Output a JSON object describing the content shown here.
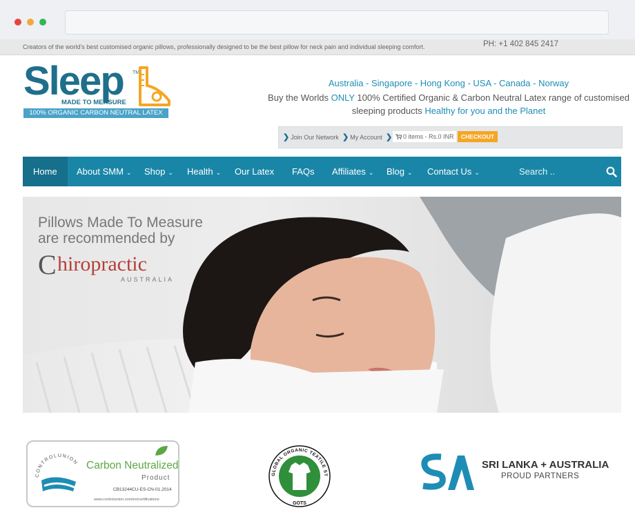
{
  "browser": {
    "window_controls": [
      "close",
      "minimize",
      "maximize"
    ]
  },
  "topbar": {
    "tagline": "Creators of the world's best customised organic pillows, professionally designed to be the best pillow for neck pain and individual sleeping comfort.",
    "phone": "PH: +1 402 845 2417"
  },
  "logo": {
    "word": "Sleep",
    "tm": "TM",
    "subtitle": "MADE TO MEASURE",
    "band": "100% ORGANIC CARBON NEUTRAL LATEX"
  },
  "header": {
    "countries": "Australia - Singapore - Hong Kong - USA - Canada - Norway",
    "buy_prefix": "Buy the Worlds ",
    "buy_only": "ONLY",
    "buy_rest": " 100% Certified Organic & Carbon Neutral Latex range of customised sleeping products ",
    "buy_healthy": "Healthy for you and the Planet"
  },
  "account_bar": {
    "join": "Join Our Network",
    "account": "My Account",
    "cart": "0 items - Rs.0 INR",
    "checkout": "CHECKOUT"
  },
  "nav": {
    "items": [
      {
        "label": "Home"
      },
      {
        "label": "About SMM"
      },
      {
        "label": "Shop"
      },
      {
        "label": "Health"
      },
      {
        "label": "Our Latex"
      },
      {
        "label": "FAQs"
      },
      {
        "label": "Affiliates"
      },
      {
        "label": "Blog"
      },
      {
        "label": "Contact Us"
      }
    ],
    "search_placeholder": "Search .."
  },
  "hero": {
    "line1": "Pillows Made To Measure",
    "line2": "are recommended by",
    "chiro_c": "C",
    "chiro_rest": "hiropractic",
    "chiro_sub": "AUSTRALIA"
  },
  "partners": {
    "carbon": {
      "arc_text": "CONTROLUNION",
      "title": "Carbon Neutralized",
      "product": "Product",
      "code": "CB13244CU-ES-CN-01.2014",
      "url": "www.controlunion.com/en/certifications"
    },
    "gots": {
      "ring_text": "GLOBAL ORGANIC TEXTILE STANDARD",
      "bottom": "GOTS"
    },
    "sa": {
      "line1": "SRI LANKA + AUSTRALIA",
      "line2": "PROUD PARTNERS"
    }
  },
  "colors": {
    "brand_teal": "#1f6f8b",
    "nav_blue": "#1a86a7",
    "nav_active": "#166f8b",
    "link_blue": "#1e8db5",
    "checkout_orange": "#f5a623",
    "chiro_red": "#b3413a",
    "carbon_green": "#5aa845"
  }
}
